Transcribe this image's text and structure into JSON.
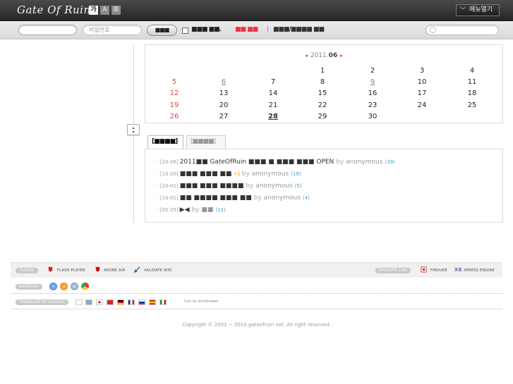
{
  "header": {
    "logo": "Gate Of Ruin",
    "font_sizes": [
      "가",
      "A",
      "あ"
    ],
    "menu_button": "메뉴열기"
  },
  "login": {
    "password_placeholder": "비밀번호",
    "login_button": "■■■",
    "keep_label": "■■■ ■■.",
    "signup_label": "■■ ■■",
    "separator": "|",
    "find_label": "■■■/■■■■ ■■"
  },
  "calendar": {
    "year": "2011.",
    "month": "06",
    "prev": "◂",
    "next": "▸",
    "days": [
      {
        "d": "1",
        "c": 3,
        "r": 0,
        "t": "normal"
      },
      {
        "d": "2",
        "c": 4,
        "r": 0,
        "t": "normal"
      },
      {
        "d": "3",
        "c": 5,
        "r": 0,
        "t": "normal"
      },
      {
        "d": "4",
        "c": 6,
        "r": 0,
        "t": "normal"
      },
      {
        "d": "5",
        "c": 0,
        "r": 1,
        "t": "sun"
      },
      {
        "d": "6",
        "c": 1,
        "r": 1,
        "t": "mark"
      },
      {
        "d": "7",
        "c": 2,
        "r": 1,
        "t": "normal"
      },
      {
        "d": "8",
        "c": 3,
        "r": 1,
        "t": "normal"
      },
      {
        "d": "9",
        "c": 4,
        "r": 1,
        "t": "mark"
      },
      {
        "d": "10",
        "c": 5,
        "r": 1,
        "t": "normal"
      },
      {
        "d": "11",
        "c": 6,
        "r": 1,
        "t": "normal"
      },
      {
        "d": "12",
        "c": 0,
        "r": 2,
        "t": "sun"
      },
      {
        "d": "13",
        "c": 1,
        "r": 2,
        "t": "normal"
      },
      {
        "d": "14",
        "c": 2,
        "r": 2,
        "t": "normal"
      },
      {
        "d": "15",
        "c": 3,
        "r": 2,
        "t": "normal"
      },
      {
        "d": "16",
        "c": 4,
        "r": 2,
        "t": "normal"
      },
      {
        "d": "17",
        "c": 5,
        "r": 2,
        "t": "normal"
      },
      {
        "d": "18",
        "c": 6,
        "r": 2,
        "t": "normal"
      },
      {
        "d": "19",
        "c": 0,
        "r": 3,
        "t": "sun"
      },
      {
        "d": "20",
        "c": 1,
        "r": 3,
        "t": "normal"
      },
      {
        "d": "21",
        "c": 2,
        "r": 3,
        "t": "normal"
      },
      {
        "d": "22",
        "c": 3,
        "r": 3,
        "t": "normal"
      },
      {
        "d": "23",
        "c": 4,
        "r": 3,
        "t": "normal"
      },
      {
        "d": "24",
        "c": 5,
        "r": 3,
        "t": "normal"
      },
      {
        "d": "25",
        "c": 6,
        "r": 3,
        "t": "normal"
      },
      {
        "d": "26",
        "c": 0,
        "r": 4,
        "t": "sun"
      },
      {
        "d": "27",
        "c": 1,
        "r": 4,
        "t": "normal"
      },
      {
        "d": "28",
        "c": 2,
        "r": 4,
        "t": "today"
      },
      {
        "d": "29",
        "c": 3,
        "r": 4,
        "t": "normal"
      },
      {
        "d": "30",
        "c": 4,
        "r": 4,
        "t": "normal"
      }
    ]
  },
  "tabs": [
    "[■■■■]",
    "[■■■■]"
  ],
  "posts": [
    {
      "date": "[10-26]",
      "title": "2011■■ GateOfRuin ■■■ ■ ■■■ ■■■ OPEN",
      "new": "",
      "by": "by",
      "author": "anonymous",
      "count": "(39)"
    },
    {
      "date": "[10-20]",
      "title": "■■■ ■■■ ■■",
      "new": "+1",
      "by": "by",
      "author": "anonymous",
      "count": "(19)"
    },
    {
      "date": "[10-01]",
      "title": "■■■ ■■■ ■■■■",
      "new": "",
      "by": "by",
      "author": "anonymous",
      "count": "(5)"
    },
    {
      "date": "[10-01]",
      "title": "■■ ■■■■ ■■■ ■■",
      "new": "",
      "by": "by",
      "author": "anonymous",
      "count": "(4)"
    },
    {
      "date": "[05-25]",
      "title": "▶◀",
      "new": "",
      "by": "by",
      "author": "■■",
      "count": "(11)"
    }
  ],
  "footer": {
    "plugin_tag": "PLUGIN",
    "plugins": [
      "FLASH PLAYER",
      "ADOBE AIR",
      "VALIDATE W3C"
    ],
    "favorite_tag": "FAVORITE LINK",
    "favorites": [
      "FINUUKE",
      "XPRESS ENGINE"
    ],
    "xe_logo": "XE",
    "browser_tag": "BROWSER",
    "translate_tag": "TRANSLATE BY GOOGLE",
    "icon_by": "Icon by",
    "icon_author": "ikonDrawer",
    "copyright": "Copyright © 2001 ~ 2010 gateofruin.net. All right reserved."
  },
  "colors": {
    "sunday": "#e8442f",
    "accent_red": "#e23333",
    "count_blue": "#4a9bc4",
    "new_orange": "#ff9900"
  }
}
